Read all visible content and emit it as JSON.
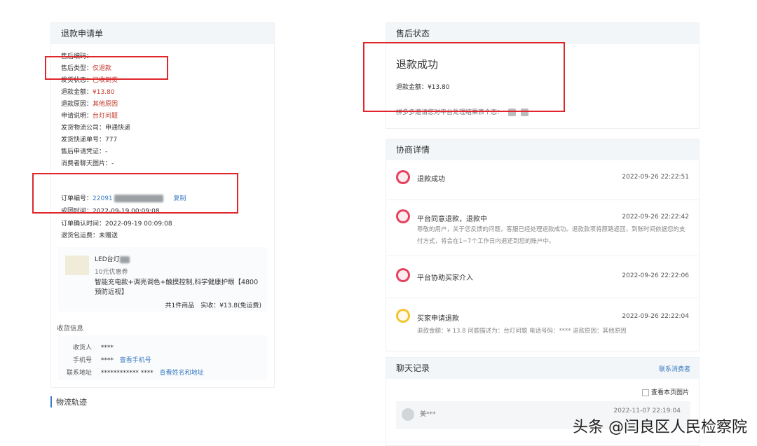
{
  "left_panel": {
    "title": "退款申请单",
    "fields": [
      {
        "label": "售后编码：",
        "value": ""
      },
      {
        "label": "售后类型：",
        "value": "仅退款"
      },
      {
        "label": "发货状态：",
        "value": "已收到货"
      },
      {
        "label": "退款金额：",
        "value": "¥13.80"
      },
      {
        "label": "退款原因：",
        "value": "其他原因"
      },
      {
        "label": "申请说明：",
        "value": "台灯问题"
      },
      {
        "label": "发货物流公司：",
        "value": "申通快递"
      },
      {
        "label": "发货快递单号：",
        "value": "777"
      },
      {
        "label": "售后申请凭证：",
        "value": "-"
      },
      {
        "label": "消费者聊天图片：",
        "value": "-"
      }
    ],
    "order": {
      "order_no_label": "订单编号：",
      "order_no_value": "22091",
      "copy_label": "复制",
      "created_label": "成团时间：",
      "created_value": "2022-09-19 00:09:08",
      "confirmed_label": "订单确认时间：",
      "confirmed_value": "2022-09-19 00:09:08",
      "shipping_label": "退货包运费：",
      "shipping_value": "未赠送"
    },
    "product": {
      "name": "LED台灯",
      "coupon": "10元优惠券",
      "desc": "智能充电款+调亮调色+触摸控制,科学健康护眼【4800预防近视】",
      "summary": "共1件商品　实收：¥13.8(免运费)"
    },
    "receiver": {
      "section_title": "收货信息",
      "name_label": "收货人",
      "name_value": "****",
      "phone_label": "手机号",
      "phone_value": "****",
      "phone_link": "查看手机号",
      "addr_label": "联系地址",
      "addr_value": "************ ****",
      "addr_link": "查看姓名和地址"
    },
    "logistics_title": "物流轨迹"
  },
  "status_panel": {
    "title": "售后状态",
    "status": "退款成功",
    "amount": "退款金额：¥13.80",
    "feedback": "拼多多邀请您对平台处理结果表个态："
  },
  "negotiation": {
    "title": "协商详情",
    "events": [
      {
        "title": "退款成功",
        "time": "2022-09-26 22:22:51",
        "body": ""
      },
      {
        "title": "平台同意退款，退款中",
        "time": "2022-09-26 22:22:42",
        "body": "尊敬的用户，关于您反馈的问题，客服已经处理退款成功。退款款项将原路返回，到账时间依据您的支付方式，将会在1~7个工作日内退还到您的账户中。"
      },
      {
        "title": "平台协助买家介入",
        "time": "2022-09-26 22:22:06",
        "body": ""
      },
      {
        "title": "买家申请退款",
        "time": "2022-09-26 22:22:04",
        "body": "退款金额：¥ 13.8 问题描述为：台灯问题 电话号码：**** 退款原因：其他原因"
      }
    ]
  },
  "chat": {
    "title": "聊天记录",
    "contact_link": "联系消费者",
    "view_checkbox": "查看本页图片",
    "first_name": "美***",
    "first_time": "2022-11-07 22:19:04"
  },
  "watermark": "头条 @闫良区人民检察院"
}
